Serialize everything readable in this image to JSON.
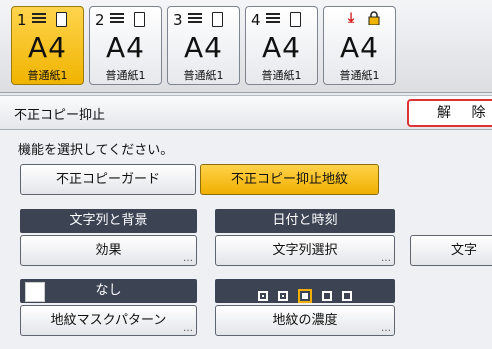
{
  "trays": [
    {
      "num": "1",
      "size": "A4",
      "paper": "普通紙1",
      "selected": true
    },
    {
      "num": "2",
      "size": "A4",
      "paper": "普通紙1",
      "selected": false
    },
    {
      "num": "3",
      "size": "A4",
      "paper": "普通紙1",
      "selected": false
    },
    {
      "num": "4",
      "size": "A4",
      "paper": "普通紙1",
      "selected": false
    },
    {
      "num": "",
      "size": "A4",
      "paper": "普通紙1",
      "selected": false,
      "icon": "bypass-tray-icon"
    }
  ],
  "panel": {
    "title": "不正コピー抑止",
    "cancel_label": "解 除",
    "prompt": "機能を選択してください。",
    "mode_buttons": [
      "不正コピーガード",
      "不正コピー抑止地紋"
    ],
    "active_mode": "不正コピー抑止地紋",
    "sections": {
      "text_bg_header": "文字列と背景",
      "effect_button": "効果",
      "date_time_header": "日付と時刻",
      "string_select_button": "文字列選択",
      "third_button": "文字",
      "none_header": "なし",
      "pattern_button": "地紋マスクパターン",
      "density_button": "地紋の濃度",
      "density_level": 3,
      "density_levels": 5
    }
  },
  "colors": {
    "accent": "#f1b000",
    "header": "#3c4454",
    "cancel_border": "#dd3333"
  }
}
